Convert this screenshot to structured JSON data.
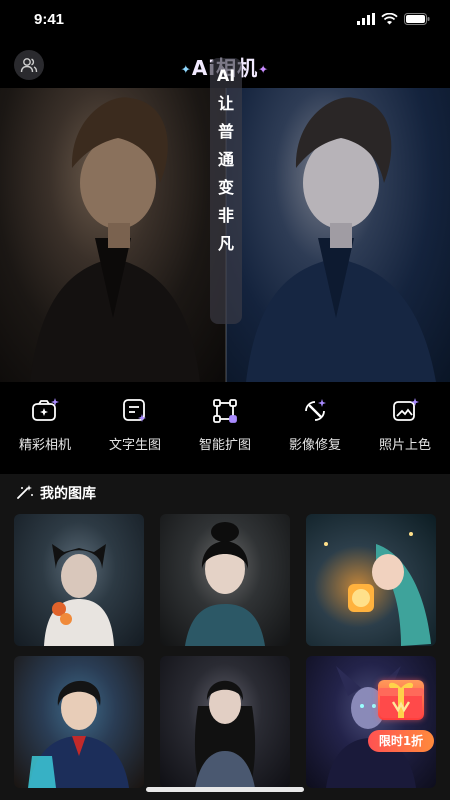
{
  "status_bar": {
    "time": "9:41"
  },
  "header": {
    "title": "Ai相机",
    "user_icon": "user-icon"
  },
  "hero": {
    "tag_chars": [
      "AI",
      "让",
      "普",
      "通",
      "变",
      "非",
      "凡"
    ]
  },
  "tools": [
    {
      "label": "精彩相机",
      "icon": "camera-sparkle-icon"
    },
    {
      "label": "文字生图",
      "icon": "text-image-icon"
    },
    {
      "label": "智能扩图",
      "icon": "expand-image-icon"
    },
    {
      "label": "影像修复",
      "icon": "magic-wand-icon"
    },
    {
      "label": "照片上色",
      "icon": "color-photo-icon"
    }
  ],
  "gallery": {
    "title": "我的图库",
    "icon": "magic-wand-small-icon",
    "item_count": 6
  },
  "promo": {
    "badge": "限时1折",
    "icon": "gift-icon"
  },
  "colors": {
    "background": "#000000",
    "panel": "#141414",
    "accent": "#c88bff",
    "promo": "#ff5252"
  }
}
